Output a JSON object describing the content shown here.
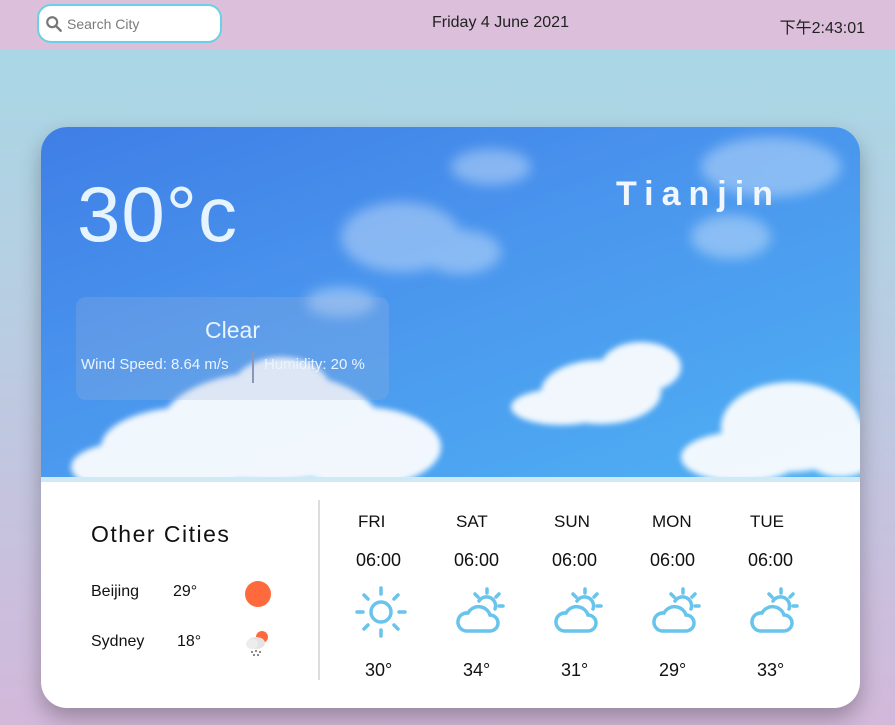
{
  "header": {
    "search_placeholder": "Search City",
    "date": "Friday 4 June 2021",
    "time": "下午2:43:01"
  },
  "current": {
    "temperature": "30°c",
    "city": "Tianjin",
    "condition": "Clear",
    "wind": "Wind Speed: 8.64 m/s",
    "humidity": "Humidity: 20 %"
  },
  "other_cities": {
    "title": "Other Cities",
    "items": [
      {
        "name": "Beijing",
        "temp": "29°",
        "icon": "sun-icon"
      },
      {
        "name": "Sydney",
        "temp": "18°",
        "icon": "rain-icon"
      }
    ]
  },
  "forecast": [
    {
      "day": "FRI",
      "time": "06:00",
      "temp": "30°",
      "icon": "sun-icon"
    },
    {
      "day": "SAT",
      "time": "06:00",
      "temp": "34°",
      "icon": "partly-cloudy-icon"
    },
    {
      "day": "SUN",
      "time": "06:00",
      "temp": "31°",
      "icon": "partly-cloudy-icon"
    },
    {
      "day": "MON",
      "time": "06:00",
      "temp": "29°",
      "icon": "partly-cloudy-icon"
    },
    {
      "day": "TUE",
      "time": "06:00",
      "temp": "33°",
      "icon": "partly-cloudy-icon"
    }
  ],
  "colors": {
    "topbar": "#dcbfdb",
    "search_border": "#6ad0e3",
    "sky": "#4a96ee",
    "weather_icon": "#67c4ec",
    "sun_dot": "#ff6a3d"
  }
}
